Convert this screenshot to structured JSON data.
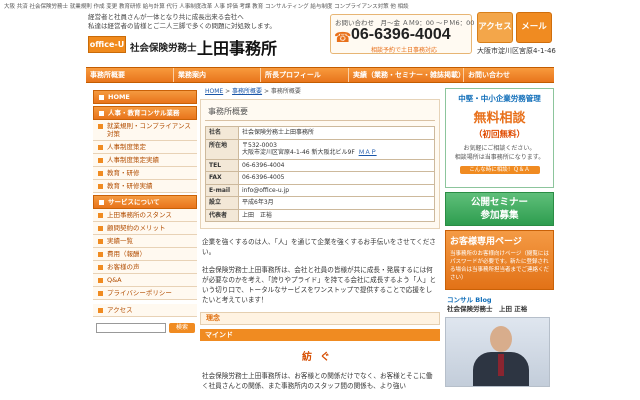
{
  "header": {
    "topline": "大阪 共済 社会保険労務士 就業規則 作成 変更 教育研修 給与計算 代行 人事制度改革 人事 評価 考課 教育 コンサルティング 給与制度 コンプライアンス対策 他 相談",
    "tagline_1": "経営者と社員さんが一体となり共に成長出来る会社へ",
    "tagline_2": "私達は経営者の皆様とご二人三脚で多くの問題に対処致します。",
    "logo_text": "office-U",
    "brand_small": "社会保険労務士",
    "brand_big": "上田事務所",
    "contact_label": "お問い合わせ　月〜金 ＡＭ9：00 〜ＰＭ6：00",
    "phone_icon": "☎",
    "tel": "06-6396-4004",
    "contact_note": "相談予約で土日事務対応",
    "access_label": "アクセス",
    "mail_label": "メール",
    "address": "大阪市淀川区宮原4-1-46"
  },
  "nav": [
    "事務所概要",
    "業務案内",
    "所長プロフィール",
    "実績（業務・セミナー・雑誌掲載）",
    "お問い合わせ"
  ],
  "sidebar": {
    "items": [
      {
        "label": "HOME",
        "kind": "sec"
      },
      {
        "label": "人事・教育コンサル業務",
        "kind": "sec"
      },
      {
        "label": "就業規則・コンプライアンス対策",
        "kind": "plain"
      },
      {
        "label": "人事制度策定",
        "kind": "plain"
      },
      {
        "label": "人事制度策定実績",
        "kind": "plain"
      },
      {
        "label": "教育・研修",
        "kind": "plain"
      },
      {
        "label": "教育・研修実績",
        "kind": "plain"
      },
      {
        "label": "サービスについて",
        "kind": "sec"
      },
      {
        "label": "上田事務所のスタンス",
        "kind": "plain"
      },
      {
        "label": "顧問契約のメリット",
        "kind": "plain"
      },
      {
        "label": "実績一覧",
        "kind": "plain"
      },
      {
        "label": "費用（報酬）",
        "kind": "plain"
      },
      {
        "label": "お客様の声",
        "kind": "plain"
      },
      {
        "label": "Q&A",
        "kind": "plain"
      },
      {
        "label": "プライバシーポリシー",
        "kind": "plain"
      },
      {
        "label": "アクセス",
        "kind": "plain"
      }
    ],
    "search_button": "検索"
  },
  "main": {
    "crumb_home": "HOME",
    "crumb_sep1": " > ",
    "crumb_mid": "事務所概要",
    "crumb_sep2": " > ",
    "crumb_current": "事務所概要",
    "panel_title": "事務所概要",
    "profile": [
      {
        "k": "社名",
        "v": "社会保険労務士上田事務所"
      },
      {
        "k": "所在地",
        "v": "〒532-0003",
        "v2": "大阪市淀川区宮原4-1-46 新大阪北ビル9F",
        "map": "ＭＡＰ"
      },
      {
        "k": "TEL",
        "v": "06-6396-4004"
      },
      {
        "k": "FAX",
        "v": "06-6396-4005"
      },
      {
        "k": "E-mail",
        "v": "info@office-u.jp"
      },
      {
        "k": "設立",
        "v": "平成6年3月"
      },
      {
        "k": "代表者",
        "v": "上田　正裕"
      }
    ],
    "para1": "企業を強くするのは人、「人」を通じて企業を強くするお手伝いをさせてください。",
    "para2": "社会保険労務士上田事務所は、会社と社員の皆様が共に成長・発展するには何が必要なのかを考え、「誇りやプライド」を持てる会社に成長するよう「人」という切り口で、トータルなサービスをワンストップで提供することで応援をしたいと考えています！",
    "heading1": "理念",
    "heading2": "マインド",
    "kizuna": "紡ぐ",
    "para3": "社会保険労務士上田事務所は、お客様との関係だけでなく、お客様とそこに働く社員さんとの関係、また事務所内のスタッフ間の関係も、より強い"
  },
  "right": {
    "b1_t1": "中堅・中小企業労務管理",
    "b1_t2": "無料相談",
    "b1_t3": "（初回無料）",
    "b1_t4a": "お気軽にご相談ください。",
    "b1_t4b": "相談場所は当事務所になります。",
    "b1_t5": "こんな時に相談！Ｑ＆Ａ",
    "b2_a": "公開セミナー",
    "b2_b": "参加募集",
    "b3_t1": "お客様専用ページ",
    "b3_t2": "当事務所のお客様向けページ（閲覧にはパスワードが必要です。新たに登録される場合は当事務所担当者までご連絡ください）",
    "blog_t": "コンサル Blog",
    "blog_name": "社会保険労務士　上田 正裕"
  }
}
